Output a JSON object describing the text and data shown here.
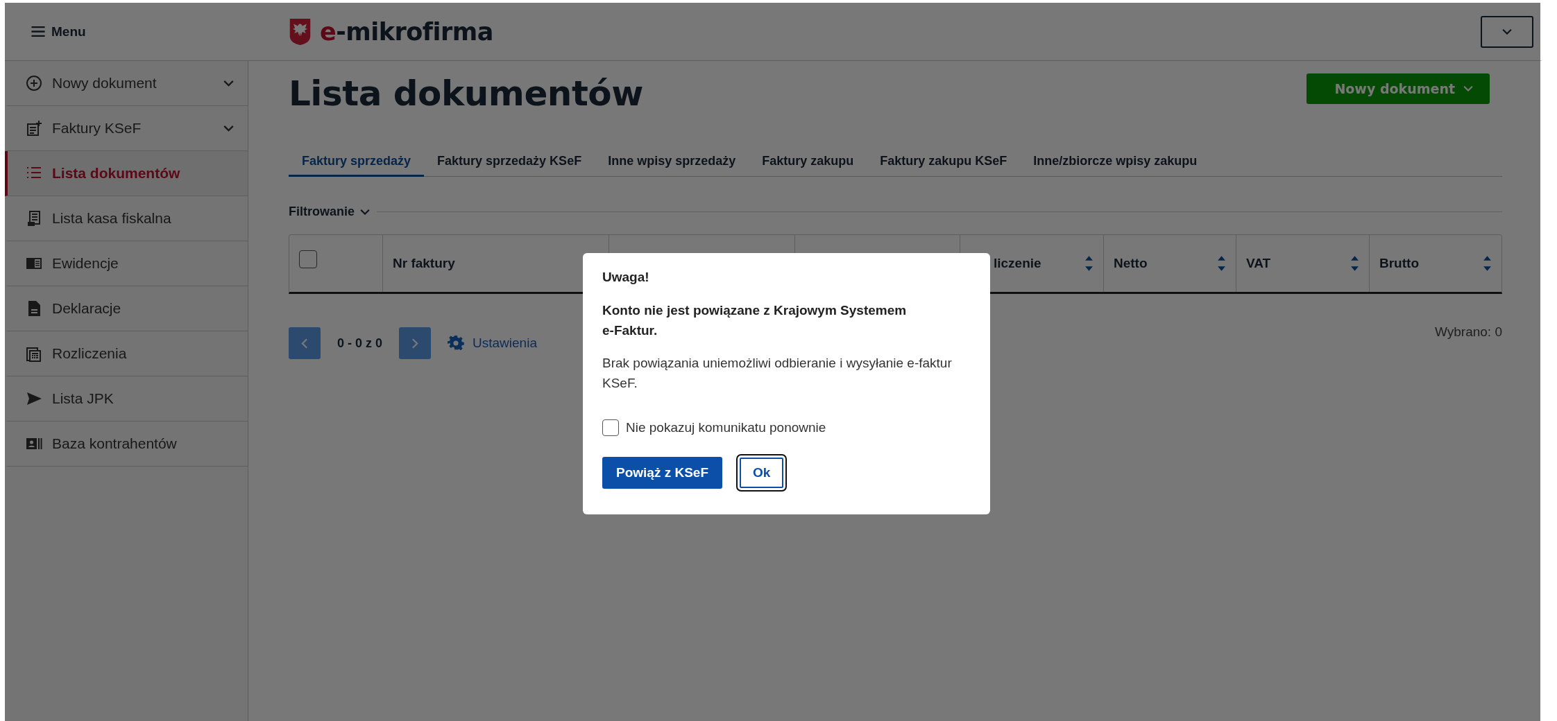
{
  "header": {
    "menu_label": "Menu",
    "logo_text": "e-mikrofirma"
  },
  "sidebar": {
    "items": [
      {
        "label": "Nowy dokument",
        "has_children": true,
        "selected": false
      },
      {
        "label": "Faktury KSeF",
        "has_children": true,
        "selected": false
      },
      {
        "label": "Lista dokumentów",
        "has_children": false,
        "selected": true
      },
      {
        "label": "Lista kasa fiskalna",
        "has_children": false,
        "selected": false
      },
      {
        "label": "Ewidencje",
        "has_children": false,
        "selected": false
      },
      {
        "label": "Deklaracje",
        "has_children": false,
        "selected": false
      },
      {
        "label": "Rozliczenia",
        "has_children": false,
        "selected": false
      },
      {
        "label": "Lista JPK",
        "has_children": false,
        "selected": false
      },
      {
        "label": "Baza kontrahentów",
        "has_children": false,
        "selected": false
      }
    ]
  },
  "page": {
    "title": "Lista dokumentów",
    "new_button": "Nowy dokument",
    "tabs": [
      {
        "label": "Faktury sprzedaży",
        "selected": true
      },
      {
        "label": "Faktury sprzedaży KSeF",
        "selected": false
      },
      {
        "label": "Inne wpisy sprzedaży",
        "selected": false
      },
      {
        "label": "Faktury zakupu",
        "selected": false
      },
      {
        "label": "Faktury zakupu KSeF",
        "selected": false
      },
      {
        "label": "Inne/zbiorcze wpisy zakupu",
        "selected": false
      }
    ],
    "filter_label": "Filtrowanie",
    "table": {
      "select_all": {
        "checked": false
      },
      "columns": [
        {
          "label": "Nr faktury"
        },
        {},
        {},
        {
          "label": "liczenie",
          "sortable": true
        },
        {
          "label": "Netto",
          "sortable": true
        },
        {
          "label": "VAT",
          "sortable": true
        },
        {
          "label": "Brutto",
          "sortable": true
        }
      ]
    },
    "pagination": {
      "range": "0 - 0 z 0",
      "settings_label": "Ustawienia",
      "selected_count": "Wybrano: 0"
    }
  },
  "dialog": {
    "title": "Uwaga!",
    "heading": "Konto nie jest powiązane z Krajowym Systemem e-Faktur.",
    "message": "Brak powiązania uniemożliwi odbieranie i wysyłanie e-faktur KSeF.",
    "dont_show_again": {
      "label": "Nie pokazuj komunikatu ponownie",
      "checked": false
    },
    "buttons": [
      {
        "label": "Powiąż z KSeF",
        "kind": "primary",
        "focused": false
      },
      {
        "label": "Ok",
        "kind": "secondary",
        "focused": true
      }
    ]
  }
}
